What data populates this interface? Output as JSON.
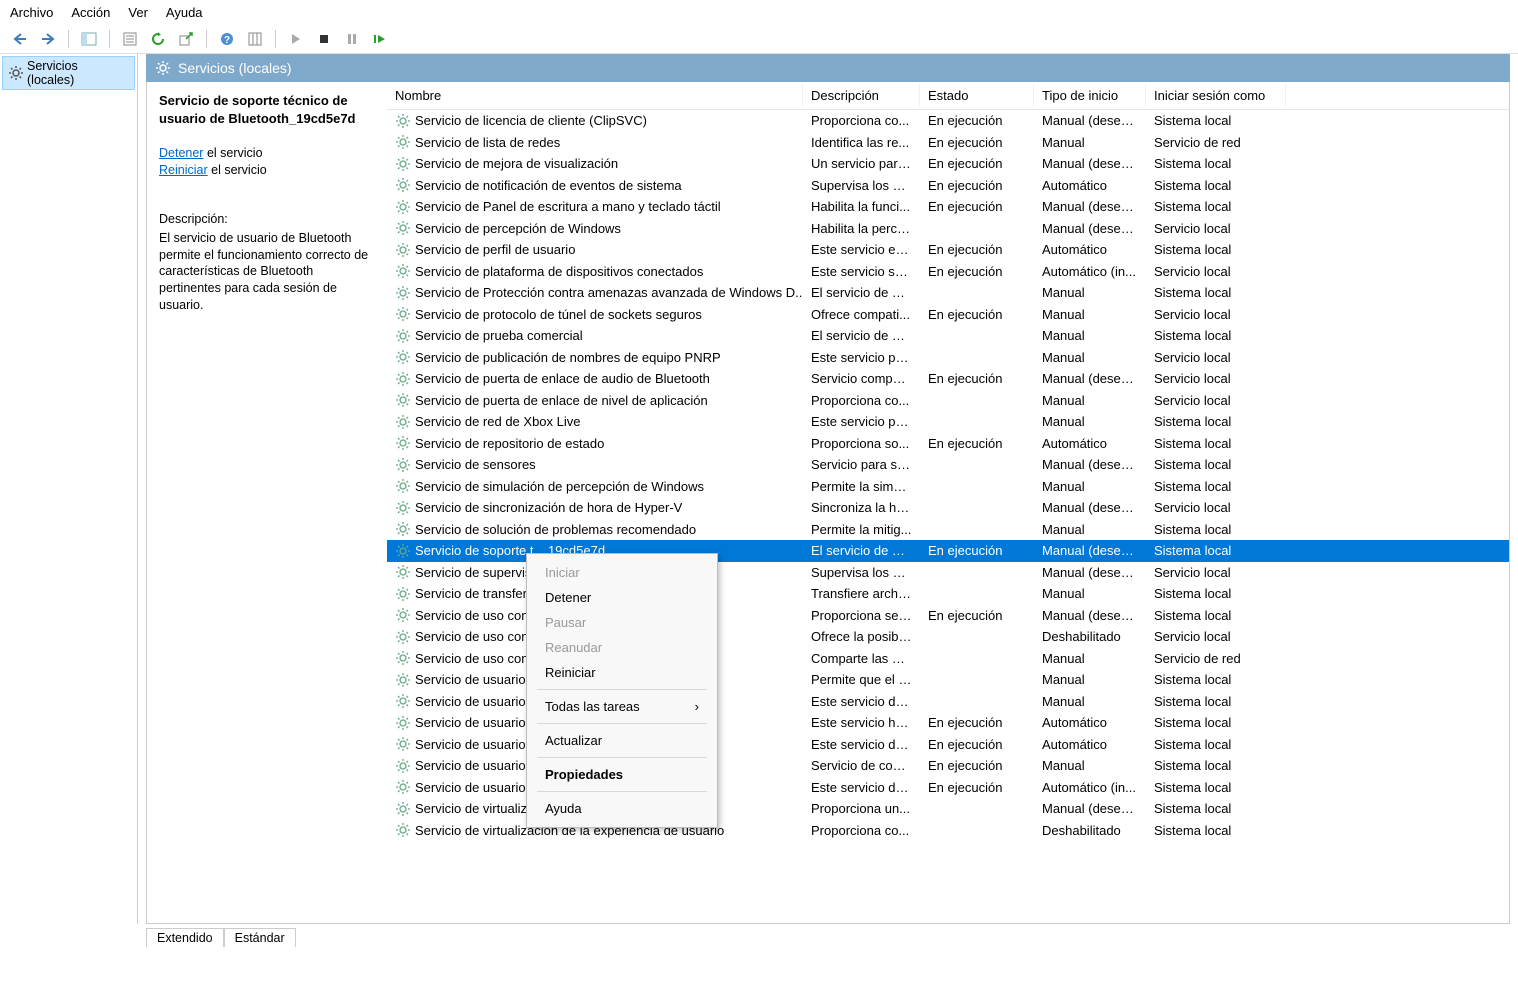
{
  "menubar": {
    "items": [
      "Archivo",
      "Acción",
      "Ver",
      "Ayuda"
    ]
  },
  "toolbar": {
    "back": "back-icon",
    "fwd": "forward-icon",
    "up": "up-icon",
    "show": "show-pane-icon",
    "export": "export-icon",
    "refresh": "refresh-icon",
    "help": "help-icon",
    "cols": "columns-icon",
    "play": "play-icon",
    "stop": "stop-icon",
    "pause": "pause-icon",
    "restart": "restart-icon"
  },
  "tree": {
    "root": "Servicios (locales)"
  },
  "panel_header": "Servicios (locales)",
  "detail": {
    "title": "Servicio de soporte técnico de usuario de Bluetooth_19cd5e7d",
    "stop_link": "Detener",
    "stop_suffix": " el servicio",
    "restart_link": "Reiniciar",
    "restart_suffix": " el servicio",
    "desc_label": "Descripción:",
    "desc_text": "El servicio de usuario de Bluetooth permite el funcionamiento correcto de características de Bluetooth pertinentes para cada sesión de usuario."
  },
  "columns": {
    "name": "Nombre",
    "desc": "Descripción",
    "state": "Estado",
    "start": "Tipo de inicio",
    "logon": "Iniciar sesión como"
  },
  "rows": [
    {
      "name": "Servicio de licencia de cliente (ClipSVC)",
      "desc": "Proporciona co...",
      "state": "En ejecución",
      "start": "Manual (desen...",
      "logon": "Sistema local"
    },
    {
      "name": "Servicio de lista de redes",
      "desc": "Identifica las re...",
      "state": "En ejecución",
      "start": "Manual",
      "logon": "Servicio de red"
    },
    {
      "name": "Servicio de mejora de visualización",
      "desc": "Un servicio para...",
      "state": "En ejecución",
      "start": "Manual (desen...",
      "logon": "Sistema local"
    },
    {
      "name": "Servicio de notificación de eventos de sistema",
      "desc": "Supervisa los ev...",
      "state": "En ejecución",
      "start": "Automático",
      "logon": "Sistema local"
    },
    {
      "name": "Servicio de Panel de escritura a mano y teclado táctil",
      "desc": "Habilita la funci...",
      "state": "En ejecución",
      "start": "Manual (desen...",
      "logon": "Sistema local"
    },
    {
      "name": "Servicio de percepción de Windows",
      "desc": "Habilita la perce...",
      "state": "",
      "start": "Manual (desen...",
      "logon": "Servicio local"
    },
    {
      "name": "Servicio de perfil de usuario",
      "desc": "Este servicio es r...",
      "state": "En ejecución",
      "start": "Automático",
      "logon": "Sistema local"
    },
    {
      "name": "Servicio de plataforma de dispositivos conectados",
      "desc": "Este servicio se ...",
      "state": "En ejecución",
      "start": "Automático (in...",
      "logon": "Servicio local"
    },
    {
      "name": "Servicio de Protección contra amenazas avanzada de Windows D...",
      "desc": "El servicio de Pr...",
      "state": "",
      "start": "Manual",
      "logon": "Sistema local"
    },
    {
      "name": "Servicio de protocolo de túnel de sockets seguros",
      "desc": "Ofrece compati...",
      "state": "En ejecución",
      "start": "Manual",
      "logon": "Servicio local"
    },
    {
      "name": "Servicio de prueba comercial",
      "desc": "El servicio de pr...",
      "state": "",
      "start": "Manual",
      "logon": "Sistema local"
    },
    {
      "name": "Servicio de publicación de nombres de equipo PNRP",
      "desc": "Este servicio pu...",
      "state": "",
      "start": "Manual",
      "logon": "Servicio local"
    },
    {
      "name": "Servicio de puerta de enlace de audio de Bluetooth",
      "desc": "Servicio compat...",
      "state": "En ejecución",
      "start": "Manual (desen...",
      "logon": "Servicio local"
    },
    {
      "name": "Servicio de puerta de enlace de nivel de aplicación",
      "desc": "Proporciona co...",
      "state": "",
      "start": "Manual",
      "logon": "Servicio local"
    },
    {
      "name": "Servicio de red de Xbox Live",
      "desc": "Este servicio pre...",
      "state": "",
      "start": "Manual",
      "logon": "Sistema local"
    },
    {
      "name": "Servicio de repositorio de estado",
      "desc": "Proporciona so...",
      "state": "En ejecución",
      "start": "Automático",
      "logon": "Sistema local"
    },
    {
      "name": "Servicio de sensores",
      "desc": "Servicio para se...",
      "state": "",
      "start": "Manual (desen...",
      "logon": "Sistema local"
    },
    {
      "name": "Servicio de simulación de percepción de Windows",
      "desc": "Permite la simul...",
      "state": "",
      "start": "Manual",
      "logon": "Sistema local"
    },
    {
      "name": "Servicio de sincronización de hora de Hyper-V",
      "desc": "Sincroniza la ho...",
      "state": "",
      "start": "Manual (desen...",
      "logon": "Servicio local"
    },
    {
      "name": "Servicio de solución de problemas recomendado",
      "desc": "Permite la mitig...",
      "state": "",
      "start": "Manual",
      "logon": "Sistema local"
    },
    {
      "name": "Servicio de soporte técnico de usuario de Bluetooth_19cd5e7d",
      "short": "Servicio de soporte t...                                           19cd5e7d",
      "desc": "El servicio de us...",
      "state": "En ejecución",
      "start": "Manual (desen...",
      "logon": "Sistema local",
      "selected": true
    },
    {
      "name": "Servicio de supervis",
      "desc": "Supervisa los di...",
      "state": "",
      "start": "Manual (desen...",
      "logon": "Servicio local"
    },
    {
      "name": "Servicio de transfer                                          o (BITS)",
      "desc": "Transfiere archiv...",
      "state": "",
      "start": "Manual",
      "logon": "Sistema local"
    },
    {
      "name": "Servicio de uso con",
      "desc": "Proporciona ser...",
      "state": "En ejecución",
      "start": "Manual (desen...",
      "logon": "Sistema local"
    },
    {
      "name": "Servicio de uso con",
      "desc": "Ofrece la posibil...",
      "state": "",
      "start": "Deshabilitado",
      "logon": "Servicio local"
    },
    {
      "name": "Servicio de uso con                                       e Windows ...",
      "desc": "Comparte las bi...",
      "state": "",
      "start": "Manual",
      "logon": "Servicio de red"
    },
    {
      "name": "Servicio de usuario",
      "desc": "Permite que el s...",
      "state": "",
      "start": "Manual",
      "logon": "Sistema local"
    },
    {
      "name": "Servicio de usuario                                         l",
      "desc": "Este servicio de ...",
      "state": "",
      "start": "Manual",
      "logon": "Sistema local"
    },
    {
      "name": "Servicio de usuario                                         Windows_1...",
      "desc": "Este servicio ho...",
      "state": "En ejecución",
      "start": "Automático",
      "logon": "Sistema local"
    },
    {
      "name": "Servicio de usuario                                         ectados_19...",
      "desc": "Este servicio de ...",
      "state": "En ejecución",
      "start": "Automático",
      "logon": "Sistema local"
    },
    {
      "name": "Servicio de usuario",
      "desc": "Servicio de com...",
      "state": "En ejecución",
      "start": "Manual",
      "logon": "Sistema local"
    },
    {
      "name": "Servicio de usuario",
      "desc": "Este servicio de ...",
      "state": "En ejecución",
      "start": "Automático (in...",
      "logon": "Sistema local"
    },
    {
      "name": "Servicio de virtualiz                                        er-V",
      "desc": "Proporciona un...",
      "state": "",
      "start": "Manual (desen...",
      "logon": "Sistema local"
    },
    {
      "name": "Servicio de virtualización de la experiencia de usuario",
      "desc": "Proporciona co...",
      "state": "",
      "start": "Deshabilitado",
      "logon": "Sistema local"
    }
  ],
  "tabs": {
    "extended": "Extendido",
    "standard": "Estándar"
  },
  "context_menu": {
    "start": "Iniciar",
    "stop": "Detener",
    "pause": "Pausar",
    "resume": "Reanudar",
    "restart": "Reiniciar",
    "all_tasks": "Todas las tareas",
    "refresh": "Actualizar",
    "props": "Propiedades",
    "help": "Ayuda",
    "arrow": "›"
  }
}
